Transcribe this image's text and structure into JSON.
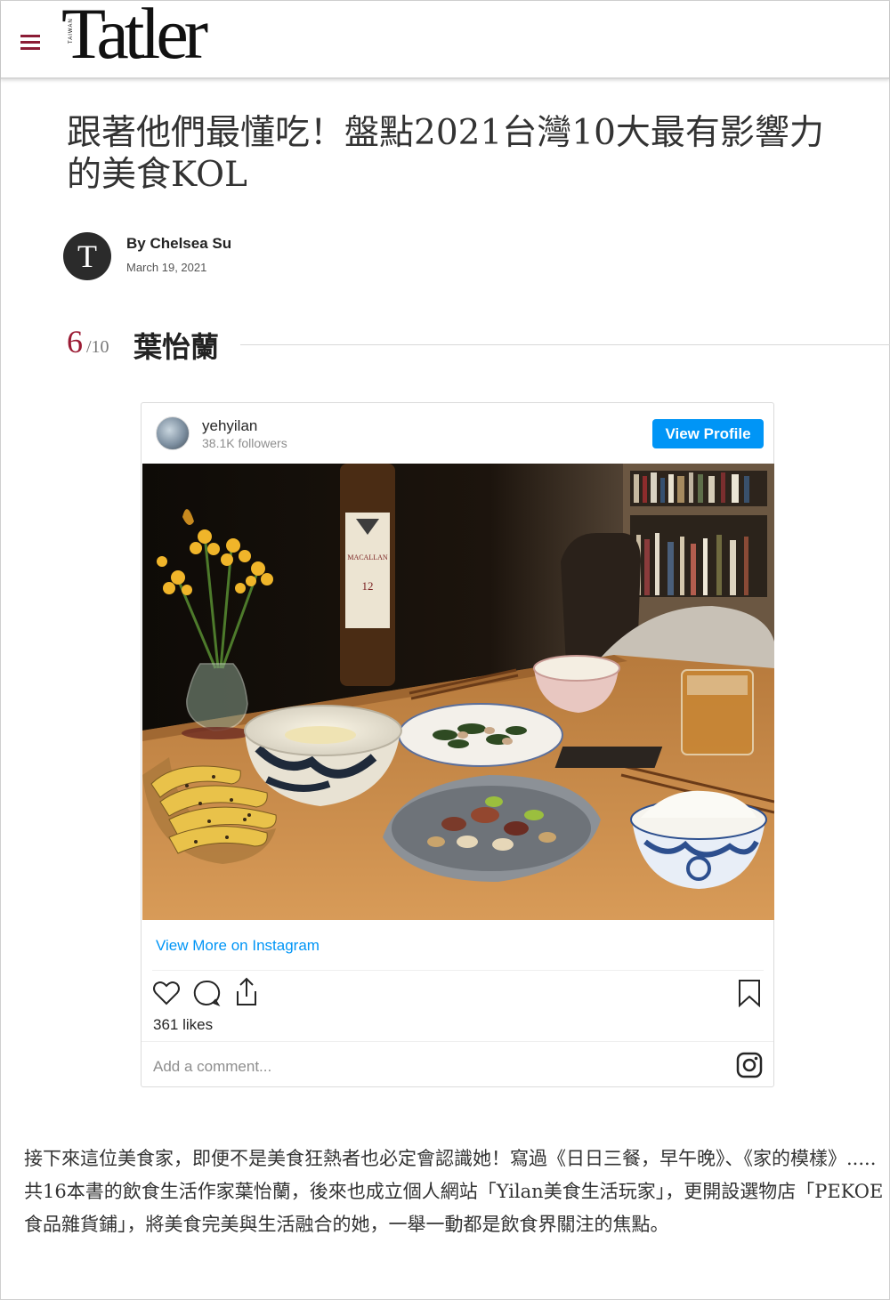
{
  "header": {
    "logo_text": "Tatler",
    "logo_sub": "TAIWAN"
  },
  "article": {
    "title": "跟著他們最懂吃！盤點2021台灣10大最有影響力的美食KOL",
    "avatar_letter": "T",
    "byline": "By Chelsea Su",
    "date": "March 19, 2021"
  },
  "section": {
    "current": "6",
    "total": "/10",
    "name": "葉怡蘭"
  },
  "instagram": {
    "username": "yehyilan",
    "followers": "38.1K followers",
    "view_profile_label": "View Profile",
    "view_more_label": "View More on Instagram",
    "likes": "361 likes",
    "comment_placeholder": "Add a comment..."
  },
  "photo_labels": {
    "bottle_brand": "MACALLAN",
    "bottle_age": "12"
  },
  "body": {
    "paragraph": "接下來這位美食家，即便不是美食狂熱者也必定會認識她！寫過《日日三餐，早午晚》、《家的模樣》.....共16本書的飲食生活作家葉怡蘭，後來也成立個人網站「Yilan美食生活玩家」，更開設選物店「PEKOE食品雜貨鋪」，將美食完美與生活融合的她，一舉一動都是飲食界關注的焦點。"
  },
  "colors": {
    "brand": "#9b1b34",
    "instagram_blue": "#0095f6"
  }
}
